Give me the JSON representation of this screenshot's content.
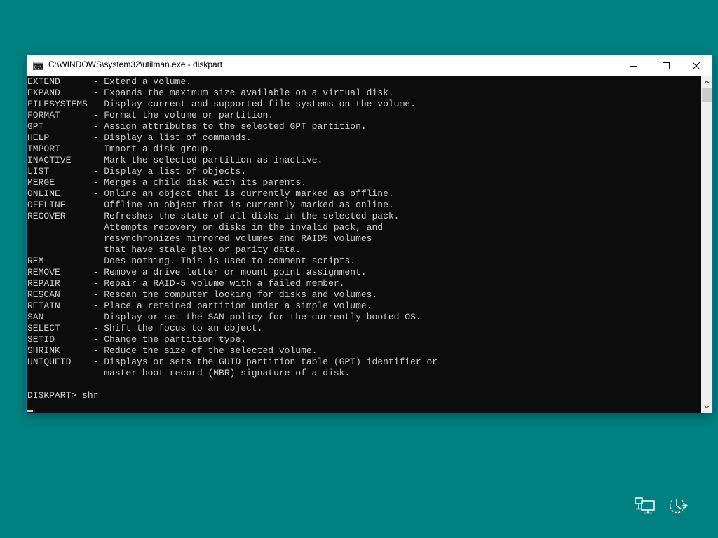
{
  "window": {
    "title": "C:\\WINDOWS\\system32\\utilman.exe - diskpart",
    "icons": {
      "app": "console-icon",
      "minimize": "minimize-icon",
      "maximize": "maximize-icon",
      "close": "close-icon"
    }
  },
  "console": {
    "lines": [
      "EXTEND      - Extend a volume.",
      "EXPAND      - Expands the maximum size available on a virtual disk.",
      "FILESYSTEMS - Display current and supported file systems on the volume.",
      "FORMAT      - Format the volume or partition.",
      "GPT         - Assign attributes to the selected GPT partition.",
      "HELP        - Display a list of commands.",
      "IMPORT      - Import a disk group.",
      "INACTIVE    - Mark the selected partition as inactive.",
      "LIST        - Display a list of objects.",
      "MERGE       - Merges a child disk with its parents.",
      "ONLINE      - Online an object that is currently marked as offline.",
      "OFFLINE     - Offline an object that is currently marked as online.",
      "RECOVER     - Refreshes the state of all disks in the selected pack.",
      "              Attempts recovery on disks in the invalid pack, and",
      "              resynchronizes mirrored volumes and RAID5 volumes",
      "              that have stale plex or parity data.",
      "REM         - Does nothing. This is used to comment scripts.",
      "REMOVE      - Remove a drive letter or mount point assignment.",
      "REPAIR      - Repair a RAID-5 volume with a failed member.",
      "RESCAN      - Rescan the computer looking for disks and volumes.",
      "RETAIN      - Place a retained partition under a simple volume.",
      "SAN         - Display or set the SAN policy for the currently booted OS.",
      "SELECT      - Shift the focus to an object.",
      "SETID       - Change the partition type.",
      "SHRINK      - Reduce the size of the selected volume.",
      "UNIQUEID    - Displays or sets the GUID partition table (GPT) identifier or",
      "              master boot record (MBR) signature of a disk.",
      "",
      "DISKPART> shr"
    ]
  },
  "scrollbar": {
    "up_icon": "scroll-up-arrow-icon",
    "down_icon": "scroll-down-arrow-icon"
  },
  "tray": {
    "network_icon": "network-icon",
    "accessibility_icon": "ease-of-access-icon"
  },
  "colors": {
    "desktop": "#008080",
    "console_bg": "#0c0c0c",
    "console_text": "#cccccc",
    "titlebar_bg": "#ffffff"
  }
}
